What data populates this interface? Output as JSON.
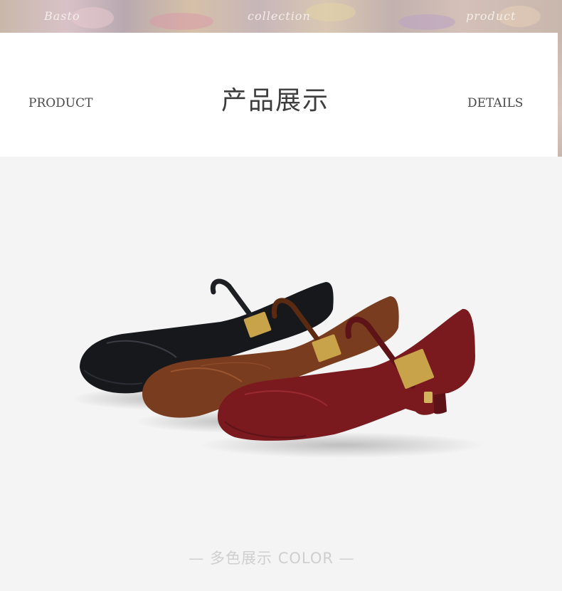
{
  "banner": {
    "left_text": "Basto",
    "center_text": "collection",
    "right_text": "product"
  },
  "header": {
    "left_word": "PRODUCT",
    "title": "产品展示",
    "right_word": "DETAILS"
  },
  "product": {
    "caption": "— 多色展示 COLOR —",
    "colors": [
      "#16181c",
      "#7a3c1e",
      "#7a1a1f"
    ],
    "hardware_color": "#c9a34a",
    "background": "#f4f4f4"
  }
}
